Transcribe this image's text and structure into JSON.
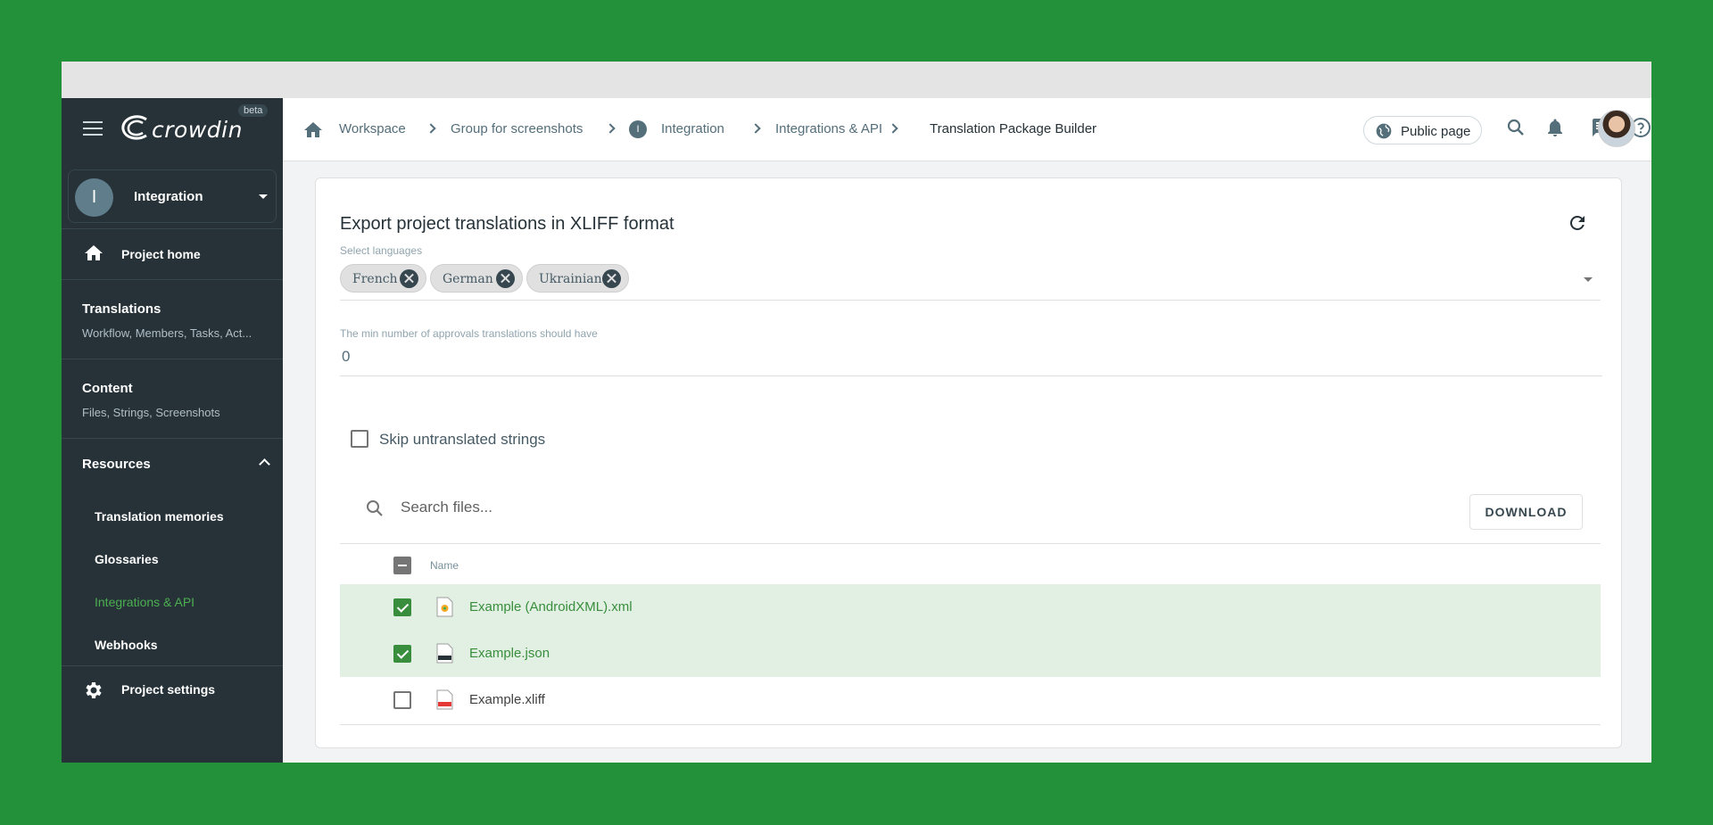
{
  "app": {
    "logo_text": "crowdin",
    "beta_label": "beta"
  },
  "sidebar": {
    "project": {
      "initial": "I",
      "name": "Integration"
    },
    "project_home": "Project home",
    "translations": {
      "label": "Translations",
      "sub": "Workflow, Members, Tasks, Act..."
    },
    "content": {
      "label": "Content",
      "sub": "Files, Strings, Screenshots"
    },
    "resources": {
      "label": "Resources",
      "items": [
        {
          "label": "Translation memories",
          "active": false
        },
        {
          "label": "Glossaries",
          "active": false
        },
        {
          "label": "Integrations & API",
          "active": true
        },
        {
          "label": "Webhooks",
          "active": false
        }
      ]
    },
    "project_settings": "Project settings"
  },
  "header": {
    "breadcrumbs": [
      "Workspace",
      "Group for screenshots",
      "Integration",
      "Integrations & API",
      "Translation Package Builder"
    ],
    "integration_badge": "I",
    "public_page": "Public page"
  },
  "main": {
    "title": "Export project translations in XLIFF format",
    "languages": {
      "label": "Select languages",
      "selected": [
        "French",
        "German",
        "Ukrainian"
      ]
    },
    "min_approvals": {
      "label": "The min number of approvals translations should have",
      "value": "0"
    },
    "skip_untranslated": {
      "label": "Skip untranslated strings",
      "checked": false
    },
    "search": {
      "placeholder": "Search files..."
    },
    "download_label": "DOWNLOAD",
    "table": {
      "column_name": "Name",
      "files": [
        {
          "name": "Example (AndroidXML).xml",
          "checked": true,
          "icon": "xml-file-icon"
        },
        {
          "name": "Example.json",
          "checked": true,
          "icon": "json-file-icon"
        },
        {
          "name": "Example.xliff",
          "checked": false,
          "icon": "xliff-file-icon"
        }
      ]
    }
  },
  "colors": {
    "background": "#23913a",
    "sidebar": "#263238",
    "accent_green": "#388e3c",
    "selected_row": "#e2f0e3"
  }
}
